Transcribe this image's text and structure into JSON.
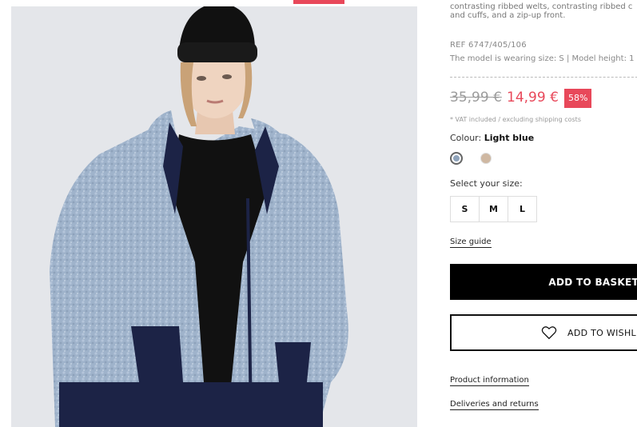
{
  "product": {
    "description_lines": [
      "contrasting ribbed welts, contrasting ribbed c",
      "and cuffs, and a zip-up front."
    ],
    "ref": "REF 6747/405/106",
    "model_info": "The model is wearing size: S | Model height: 1",
    "old_price": "35,99 €",
    "new_price": "14,99 €",
    "discount": "58%",
    "vat_note": "* VAT included / excluding shipping costs",
    "colour_label": "Colour:",
    "colour_value": "Light blue",
    "swatches": [
      "light-blue",
      "beige"
    ],
    "size_label": "Select your size:",
    "sizes": [
      "S",
      "M",
      "L"
    ],
    "size_guide": "Size guide",
    "add_to_basket": "ADD TO BASKET",
    "add_to_wishlist": "ADD TO WISHLIS",
    "product_information": "Product information",
    "deliveries_returns": "Deliveries and returns"
  },
  "colors": {
    "accent": "#e8485a",
    "swatch_blue": "#8fa3bb",
    "swatch_beige": "#cfb8a2"
  }
}
